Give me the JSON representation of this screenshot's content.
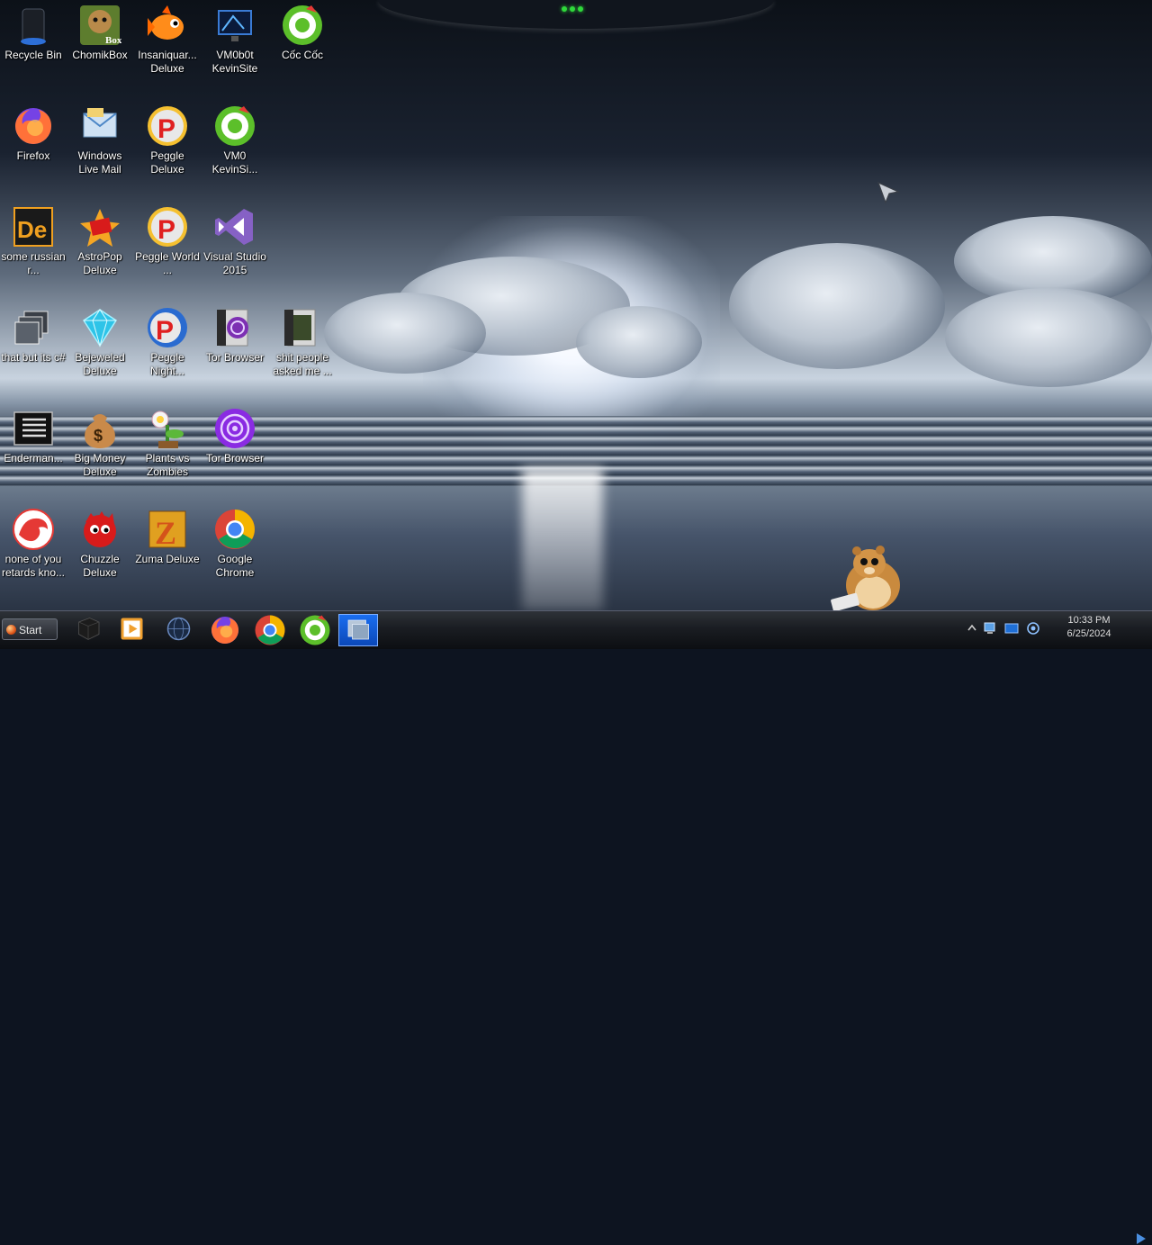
{
  "desktop": {
    "icons": [
      {
        "label": "Recycle Bin",
        "icon": "recycle-bin-icon"
      },
      {
        "label": "ChomikBox",
        "icon": "chomikbox-icon"
      },
      {
        "label": "Insaniquar... Deluxe",
        "icon": "insaniquarium-icon"
      },
      {
        "label": "VM0b0t KevinSite",
        "icon": "vm0b0t-icon"
      },
      {
        "label": "Cốc Cốc",
        "icon": "coccoc-icon"
      },
      {
        "label": "Firefox",
        "icon": "firefox-icon"
      },
      {
        "label": "Windows Live Mail",
        "icon": "windows-live-mail-icon"
      },
      {
        "label": "Peggle Deluxe",
        "icon": "peggle-icon"
      },
      {
        "label": "VM0 KevinSi...",
        "icon": "coccoc-icon"
      },
      {
        "label": "some russian r...",
        "icon": "de-app-icon"
      },
      {
        "label": "AstroPop Deluxe",
        "icon": "astropop-icon"
      },
      {
        "label": "Peggle World ...",
        "icon": "peggle-icon"
      },
      {
        "label": "Visual Studio 2015",
        "icon": "visual-studio-icon"
      },
      {
        "label": "that but its c#",
        "icon": "copy-window-icon"
      },
      {
        "label": "Bejeweled Deluxe",
        "icon": "bejeweled-icon"
      },
      {
        "label": "Peggle Night...",
        "icon": "peggle-nights-icon"
      },
      {
        "label": "Tor Browser",
        "icon": "tor-folder-icon"
      },
      {
        "label": "shit people asked me ...",
        "icon": "folder-icon"
      },
      {
        "label": "Enderman...",
        "icon": "terminal-icon"
      },
      {
        "label": "Big Money Deluxe",
        "icon": "money-bag-icon"
      },
      {
        "label": "Plants vs Zombies",
        "icon": "plants-vs-zombies-icon"
      },
      {
        "label": "Tor Browser",
        "icon": "tor-browser-icon"
      },
      {
        "label": "none of you retards kno...",
        "icon": "dragon-icon"
      },
      {
        "label": "Chuzzle Deluxe",
        "icon": "chuzzle-icon"
      },
      {
        "label": "Zuma Deluxe",
        "icon": "zuma-icon"
      },
      {
        "label": "Google Chrome",
        "icon": "chrome-icon"
      }
    ]
  },
  "taskbar": {
    "start_label": "Start",
    "pinned": [
      {
        "icon": "dark-cube-icon"
      },
      {
        "icon": "media-player-icon"
      },
      {
        "icon": "globe-icon"
      },
      {
        "icon": "firefox-icon"
      },
      {
        "icon": "chrome-icon"
      },
      {
        "icon": "coccoc-icon"
      },
      {
        "icon": "app-window-icon"
      }
    ],
    "active_index": 6,
    "clock": {
      "time": "10:33 PM",
      "date": "6/25/2024"
    }
  },
  "colors": {
    "taskbar_active": "#1a6ef0",
    "tor_purple": "#8a2be2",
    "coccoc_green": "#5cbf2a"
  }
}
